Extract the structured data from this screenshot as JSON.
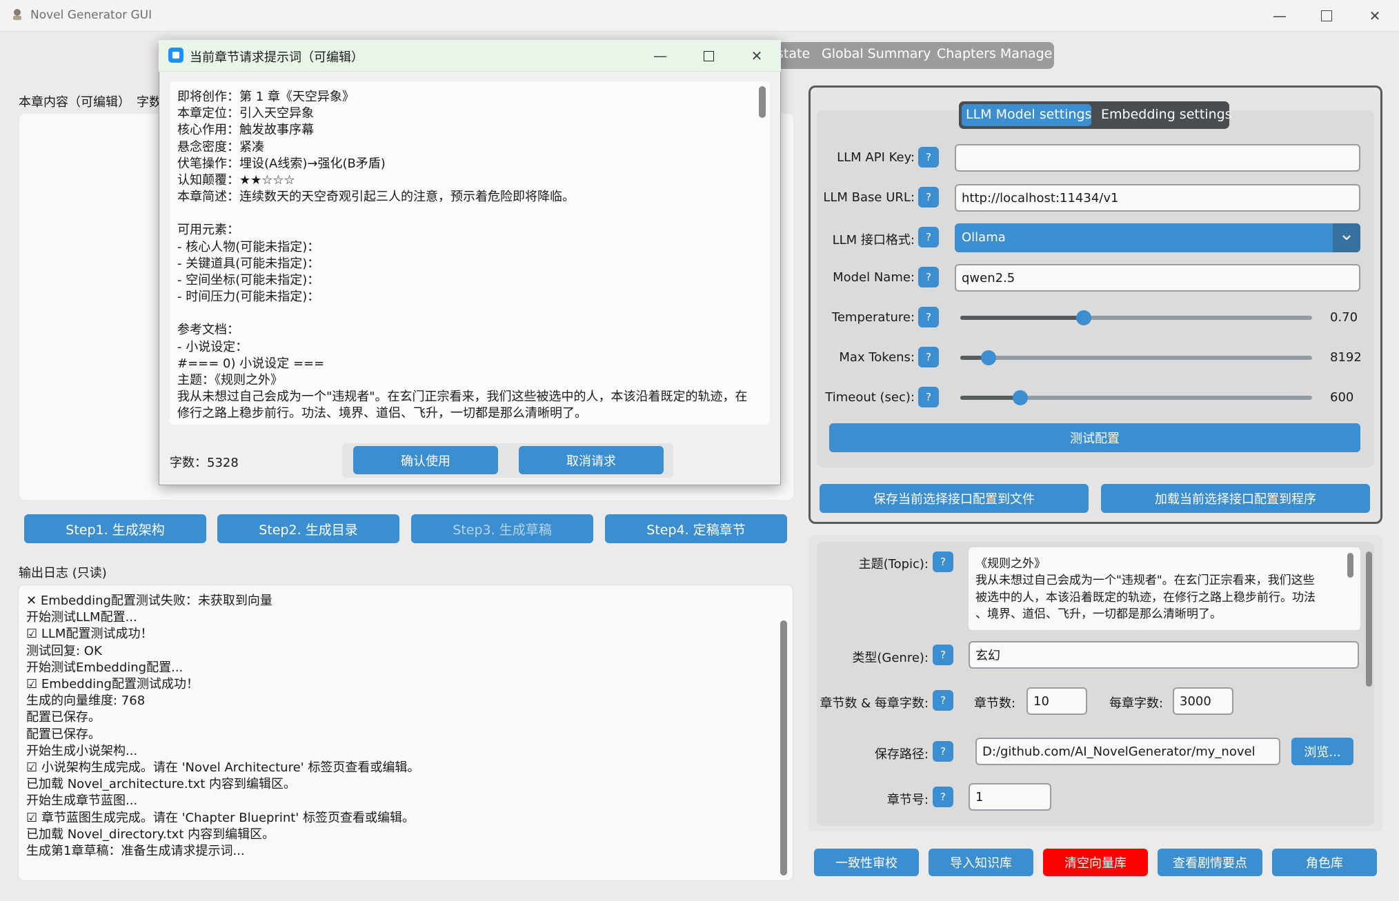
{
  "app": {
    "title": "Novel Generator GUI"
  },
  "tabs": [
    "state",
    "Global Summary",
    "Chapters Manage"
  ],
  "left": {
    "editor_label": "本章内容（可编辑）",
    "char_label": "字数",
    "steps": [
      "Step1. 生成架构",
      "Step2. 生成目录",
      "Step3. 生成草稿",
      "Step4. 定稿章节"
    ],
    "log_label": "输出日志 (只读)",
    "log_lines": [
      "Embedding配置测试失败：未获取到向量",
      "开始测试LLM配置...",
      "LLM配置测试成功！",
      "测试回复: OK",
      "开始测试Embedding配置...",
      "Embedding配置测试成功！",
      "生成的向量维度: 768",
      "配置已保存。",
      "配置已保存。",
      "开始生成小说架构...",
      "小说架构生成完成。请在 'Novel Architecture' 标签页查看或编辑。",
      "已加载 Novel_architecture.txt 内容到编辑区。",
      "开始生成章节蓝图...",
      "章节蓝图生成完成。请在 'Chapter Blueprint' 标签页查看或编辑。",
      "已加载 Novel_directory.txt 内容到编辑区。",
      "生成第1章草稿：准备生成请求提示词..."
    ]
  },
  "config": {
    "segments": [
      "LLM Model settings",
      "Embedding settings"
    ],
    "api_key_label": "LLM API Key:",
    "api_key_value": "",
    "base_url_label": "LLM Base URL:",
    "base_url_value": "http://localhost:11434/v1",
    "format_label": "LLM 接口格式:",
    "format_value": "Ollama",
    "model_label": "Model Name:",
    "model_value": "qwen2.5",
    "temperature_label": "Temperature:",
    "temperature_value": "0.70",
    "temperature_fraction": 0.35,
    "max_tokens_label": "Max Tokens:",
    "max_tokens_value": "8192",
    "max_tokens_fraction": 0.08,
    "timeout_label": "Timeout (sec):",
    "timeout_value": "600",
    "timeout_fraction": 0.17,
    "test_button": "测试配置",
    "save_button": "保存当前选择接口配置到文件",
    "load_button": "加载当前选择接口配置到程序",
    "help": "?"
  },
  "params": {
    "topic_label": "主题(Topic):",
    "topic_lines": [
      "《规则之外》",
      "我从未想过自己会成为一个\"违规者\"。在玄门正宗看来，我们这些",
      "被选中的人，本该沿着既定的轨迹，在修行之路上稳步前行。功法",
      "、境界、道侣、飞升，一切都是那么清晰明了。"
    ],
    "genre_label": "类型(Genre):",
    "genre_value": "玄幻",
    "chapters_label": "章节数 & 每章字数:",
    "chapter_count_label": "章节数:",
    "chapter_count_value": "10",
    "words_label": "每章字数:",
    "words_value": "3000",
    "path_label": "保存路径:",
    "path_value": "D:/github.com/AI_NovelGenerator/my_novel",
    "browse_button": "浏览...",
    "chapter_no_label": "章节号:",
    "chapter_no_value": "1"
  },
  "bottom_buttons": [
    "一致性审校",
    "导入知识库",
    "清空向量库",
    "查看剧情要点",
    "角色库"
  ],
  "colors": {
    "accent": "#3b8ed0",
    "danger": "#ff0000"
  },
  "dialog": {
    "title": "当前章节请求提示词（可编辑）",
    "lines": [
      "即将创作：第 1 章《天空异象》",
      "本章定位：引入天空异象",
      "核心作用：触发故事序幕",
      "悬念密度：紧凑",
      "伏笔操作：埋设(A线索)→强化(B矛盾)",
      "认知颠覆：★★☆☆☆",
      "本章简述：连续数天的天空奇观引起三人的注意，预示着危险即将降临。",
      "",
      "可用元素：",
      "- 核心人物(可能未指定)：",
      "- 关键道具(可能未指定)：",
      "- 空间坐标(可能未指定)：",
      "- 时间压力(可能未指定)：",
      "",
      "参考文档：",
      "- 小说设定：",
      "#=== 0) 小说设定 ===",
      "主题：《规则之外》",
      "我从未想过自己会成为一个\"违规者\"。在玄门正宗看来，我们这些被选中的人，本该沿着既定的轨迹，在",
      "修行之路上稳步前行。功法、境界、道侣、飞升，一切都是那么清晰明了。"
    ],
    "char_count": "字数：5328",
    "confirm_button": "确认使用",
    "cancel_button": "取消请求"
  }
}
